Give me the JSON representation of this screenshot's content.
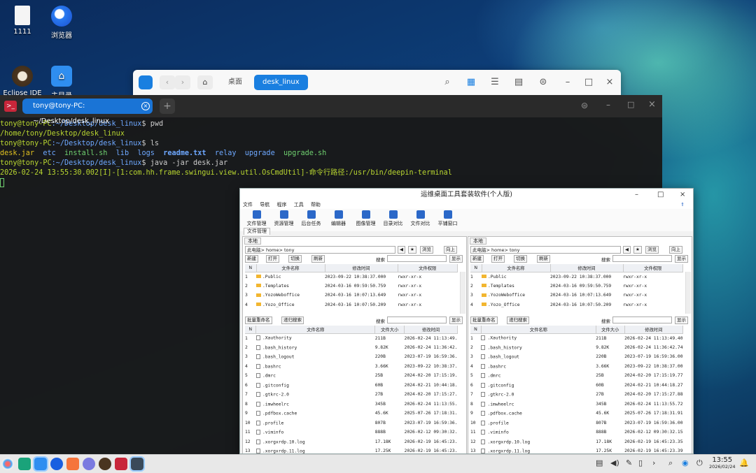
{
  "desktop": {
    "icons": [
      {
        "label": "1111"
      },
      {
        "label": "浏览器"
      },
      {
        "label": "Eclipse IDE"
      },
      {
        "label": "主目录"
      }
    ]
  },
  "file_manager": {
    "crumb_inactive": "桌面",
    "crumb_active": "desk_linux"
  },
  "terminal": {
    "tab_title": "tony@tony-PC: ~/Desktop/desk_linux",
    "prompt": "tony@tony-PC",
    "path": ":~/Desktop/desk_linux",
    "dollar": "$",
    "cmd1": " pwd",
    "out1": "/home/tony/Desktop/desk_linux",
    "cmd2": " ls",
    "ls_items": [
      "desk.jar",
      "etc",
      "install.sh",
      "lib",
      "logs",
      "readme.txt",
      "relay",
      "upgrade",
      "upgrade.sh"
    ],
    "cmd3": " java -jar desk.jar",
    "log_line": "2026-02-24 13:55:30.002[I]-[1:com.hh.frame.swingui.view.util.OsCmdUtil]-命令行路径:/usr/bin/deepin-terminal"
  },
  "app": {
    "title": "运维桌面工具套装软件(个人版)",
    "menu": [
      "文件",
      "导航",
      "程序",
      "工具",
      "帮助"
    ],
    "toolbar": [
      "文件管理",
      "资源管理",
      "后台任务",
      "编辑器",
      "图像管理",
      "目录对比",
      "文件对比",
      "平铺窗口"
    ],
    "active_tab": "文件管理",
    "panel_tab": "本地",
    "address": "此电脑> home> tony",
    "browse_btn": "浏览",
    "up_btn": "向上",
    "new_btn": "新建",
    "open_btn": "打开",
    "switch_btn": "切换",
    "refresh_btn": "刷新",
    "search_label": "搜索",
    "show_btn": "显示",
    "batch_rename": "批量重命名",
    "recursive_search": "递归搜索",
    "dir_cols": [
      "N",
      "文件名称",
      "修改时间",
      "文件权限"
    ],
    "dirs": [
      [
        "1",
        ".Public",
        "2023-09-22 10:38:37.000",
        "rwxr-xr-x"
      ],
      [
        "2",
        ".Templates",
        "2024-03-16 09:59:50.759",
        "rwxr-xr-x"
      ],
      [
        "3",
        ".YozoWeboffice",
        "2024-03-16 10:07:13.649",
        "rwxr-xr-x"
      ],
      [
        "4",
        ".Yozo_Office",
        "2024-03-16 10:07:50.209",
        "rwxr-xr-x"
      ]
    ],
    "file_cols": [
      "N",
      "文件名称",
      "文件大小",
      "修改时间"
    ],
    "files_left": [
      [
        "1",
        ".Xauthority",
        "211B",
        "2026-02-24 11:13:49."
      ],
      [
        "2",
        ".bash_history",
        "9.82K",
        "2026-02-24 11:36:42."
      ],
      [
        "3",
        ".bash_logout",
        "220B",
        "2023-07-19 16:59:36."
      ],
      [
        "4",
        ".bashrc",
        "3.66K",
        "2023-09-22 10:38:37."
      ],
      [
        "5",
        ".dmrc",
        "25B",
        "2024-02-20 17:15:19."
      ],
      [
        "6",
        ".gitconfig",
        "60B",
        "2024-02-21 10:44:18."
      ],
      [
        "7",
        ".gtkrc-2.0",
        "27B",
        "2024-02-20 17:15:27."
      ],
      [
        "8",
        ".imwheelrc",
        "345B",
        "2026-02-24 11:13:55."
      ],
      [
        "9",
        ".pdfbox.cache",
        "45.6K",
        "2025-07-26 17:18:31."
      ],
      [
        "10",
        ".profile",
        "807B",
        "2023-07-19 16:59:36."
      ],
      [
        "11",
        ".viminfo",
        "888B",
        "2026-02-12 09:30:32."
      ],
      [
        "12",
        ".xorgxrdp.10.log",
        "17.18K",
        "2026-02-19 16:45:23."
      ],
      [
        "13",
        ".xorgxrdp.11.log",
        "17.25K",
        "2026-02-19 16:45:23."
      ]
    ],
    "files_right": [
      [
        "1",
        ".Xauthority",
        "211B",
        "2026-02-24 11:13:49.40"
      ],
      [
        "2",
        ".bash_history",
        "9.82K",
        "2026-02-24 11:36:42.74"
      ],
      [
        "3",
        ".bash_logout",
        "220B",
        "2023-07-19 16:59:36.00"
      ],
      [
        "4",
        ".bashrc",
        "3.66K",
        "2023-09-22 10:38:37.00"
      ],
      [
        "5",
        ".dmrc",
        "25B",
        "2024-02-20 17:15:19.77"
      ],
      [
        "6",
        ".gitconfig",
        "60B",
        "2024-02-21 10:44:18.27"
      ],
      [
        "7",
        ".gtkrc-2.0",
        "27B",
        "2024-02-20 17:15:27.88"
      ],
      [
        "8",
        ".imwheelrc",
        "345B",
        "2026-02-24 11:13:55.72"
      ],
      [
        "9",
        ".pdfbox.cache",
        "45.6K",
        "2025-07-26 17:18:31.91"
      ],
      [
        "10",
        ".profile",
        "807B",
        "2023-07-19 16:59:36.00"
      ],
      [
        "11",
        ".viminfo",
        "888B",
        "2026-02-12 09:30:32.15"
      ],
      [
        "12",
        ".xorgxrdp.10.log",
        "17.18K",
        "2026-02-19 16:45:23.35"
      ],
      [
        "13",
        ".xorgxrdp.11.log",
        "17.25K",
        "2026-02-19 16:45:23.39"
      ]
    ]
  },
  "taskbar": {
    "time": "13:55",
    "date": "2026/02/24"
  }
}
